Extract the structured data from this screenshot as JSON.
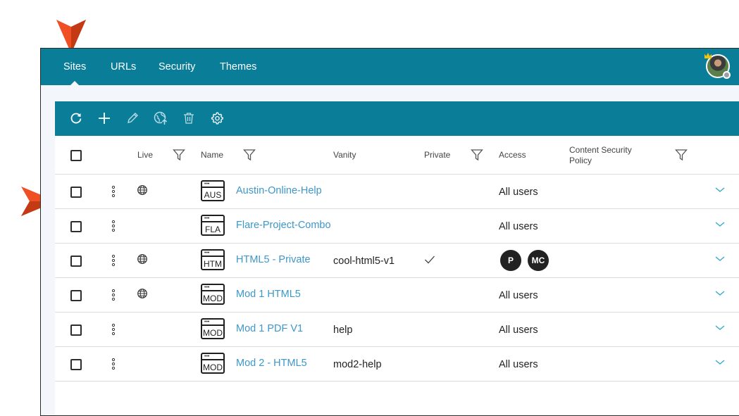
{
  "nav": {
    "tabs": [
      {
        "label": "Sites",
        "active": true
      },
      {
        "label": "URLs",
        "active": false
      },
      {
        "label": "Security",
        "active": false
      },
      {
        "label": "Themes",
        "active": false
      }
    ]
  },
  "toolbar": {
    "icons": [
      "refresh-icon",
      "add-icon",
      "edit-icon",
      "publish-globe-icon",
      "delete-icon",
      "settings-icon"
    ]
  },
  "grid": {
    "columns": {
      "live": "Live",
      "name": "Name",
      "vanity": "Vanity",
      "private": "Private",
      "access": "Access",
      "csp_line1": "Content Security",
      "csp_line2": "Policy"
    },
    "rows": [
      {
        "icon": "AUS",
        "name": "Austin-Online-Help",
        "vanity": "",
        "private": false,
        "live": true,
        "access": "All users",
        "badges": []
      },
      {
        "icon": "FLA",
        "name": "Flare-Project-Combo",
        "vanity": "",
        "private": false,
        "live": false,
        "access": "All users",
        "badges": []
      },
      {
        "icon": "HTM",
        "name": "HTML5 - Private",
        "vanity": "cool-html5-v1",
        "private": true,
        "live": true,
        "access": "",
        "badges": [
          "P",
          "MC"
        ]
      },
      {
        "icon": "MOD",
        "name": "Mod 1 HTML5",
        "vanity": "",
        "private": false,
        "live": true,
        "access": "All users",
        "badges": []
      },
      {
        "icon": "MOD",
        "name": "Mod 1 PDF V1",
        "vanity": "help",
        "private": false,
        "live": false,
        "access": "All users",
        "badges": []
      },
      {
        "icon": "MOD",
        "name": "Mod 2 - HTML5",
        "vanity": "mod2-help",
        "private": false,
        "live": false,
        "access": "All users",
        "badges": []
      }
    ]
  },
  "colors": {
    "accent": "#0a7e99",
    "link": "#3d97c9",
    "callout": "#f04e23"
  }
}
